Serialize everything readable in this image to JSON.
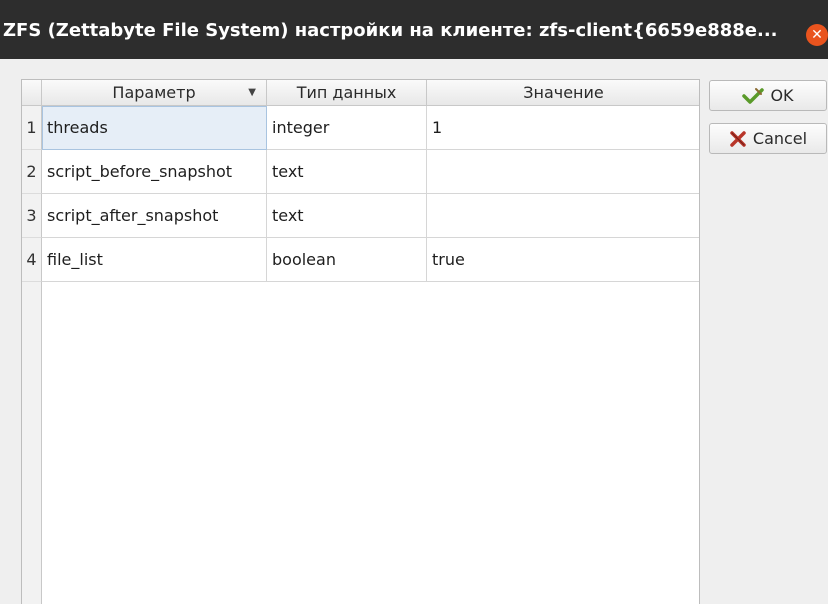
{
  "window": {
    "title": "ZFS (Zettabyte File System) настройки на клиенте: zfs-client{6659e888e...",
    "close_glyph": "✕"
  },
  "table": {
    "columns": [
      "Параметр",
      "Тип данных",
      "Значение"
    ],
    "sort_indicator": "▼",
    "rows": [
      {
        "num": "1",
        "param": "threads",
        "type": "integer",
        "value": "1"
      },
      {
        "num": "2",
        "param": "script_before_snapshot",
        "type": "text",
        "value": ""
      },
      {
        "num": "3",
        "param": "script_after_snapshot",
        "type": "text",
        "value": ""
      },
      {
        "num": "4",
        "param": "file_list",
        "type": "boolean",
        "value": "true"
      }
    ]
  },
  "buttons": {
    "ok_label": "OK",
    "cancel_label": "Cancel"
  },
  "icons": {
    "ok": "checkmark-pen-icon",
    "cancel": "cross-icon",
    "close": "close-icon"
  },
  "colors": {
    "titlebar": "#2d2d2d",
    "close_button": "#e9541e",
    "selection": "#e6eef7"
  }
}
